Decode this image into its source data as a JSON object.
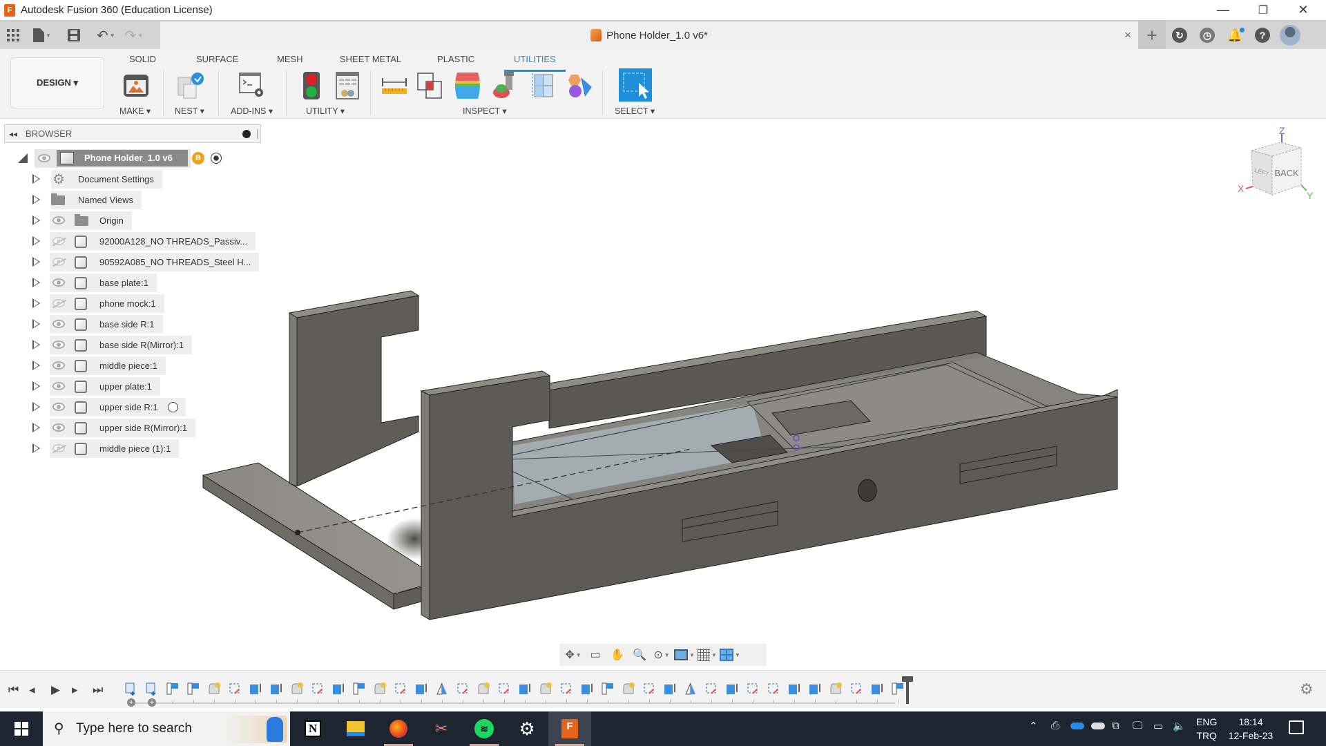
{
  "window": {
    "title": "Autodesk Fusion 360 (Education License)",
    "logo_letter": "F",
    "controls": {
      "minimize": "—",
      "restore": "❐",
      "close": "✕"
    }
  },
  "quick_access": {
    "icons": [
      "grid-menu-icon",
      "file-icon",
      "save-icon",
      "undo-icon",
      "redo-icon"
    ],
    "document_tab": {
      "name": "Phone Holder_1.0 v6*",
      "close": "×"
    },
    "right_icons": [
      "new-tab-icon",
      "extensions-icon",
      "job-status-icon",
      "notifications-icon",
      "help-icon",
      "user-avatar"
    ]
  },
  "ribbon": {
    "workspace": "DESIGN ▾",
    "tabs": [
      {
        "label": "SOLID",
        "active": false
      },
      {
        "label": "SURFACE",
        "active": false
      },
      {
        "label": "MESH",
        "active": false
      },
      {
        "label": "SHEET METAL",
        "active": false
      },
      {
        "label": "PLASTIC",
        "active": false
      },
      {
        "label": "UTILITIES",
        "active": true
      }
    ],
    "groups": [
      {
        "label": "MAKE ▾"
      },
      {
        "label": "NEST ▾"
      },
      {
        "label": "ADD-INS ▾"
      },
      {
        "label": "UTILITY ▾"
      },
      {
        "label": "INSPECT ▾"
      },
      {
        "label": "SELECT ▾"
      }
    ],
    "accent": "#1e8fd8"
  },
  "browser": {
    "title": "BROWSER",
    "root": {
      "label": "Phone Holder_1.0 v6",
      "badge": "B"
    },
    "items": [
      {
        "label": "Document Settings",
        "icon": "gear",
        "visible": null
      },
      {
        "label": "Named Views",
        "icon": "folder",
        "visible": null
      },
      {
        "label": "Origin",
        "icon": "folder",
        "visible": true
      },
      {
        "label": "92000A128_NO THREADS_Passiv...",
        "icon": "body",
        "visible": false
      },
      {
        "label": "90592A085_NO THREADS_Steel H...",
        "icon": "body",
        "visible": false
      },
      {
        "label": "base plate:1",
        "icon": "body",
        "visible": true
      },
      {
        "label": "phone mock:1",
        "icon": "body",
        "visible": false
      },
      {
        "label": "base side R:1",
        "icon": "body",
        "visible": true
      },
      {
        "label": "base side R(Mirror):1",
        "icon": "body",
        "visible": true
      },
      {
        "label": "middle piece:1",
        "icon": "body",
        "visible": true
      },
      {
        "label": "upper plate:1",
        "icon": "body",
        "visible": true
      },
      {
        "label": "upper side R:1",
        "icon": "body",
        "visible": true,
        "activate_radio": true
      },
      {
        "label": "upper side R(Mirror):1",
        "icon": "body",
        "visible": true
      },
      {
        "label": "middle piece (1):1",
        "icon": "body",
        "visible": false
      }
    ]
  },
  "viewcube": {
    "face": "BACK",
    "side": "LEFT",
    "axes": {
      "x": "X",
      "y": "Y",
      "z": "Z"
    }
  },
  "navbar": {
    "icons": [
      "orbit-icon",
      "look-at-icon",
      "pan-icon",
      "zoom-icon",
      "fit-icon",
      "display-settings-icon",
      "grid-icon",
      "viewports-icon"
    ]
  },
  "timeline": {
    "controls": [
      "first",
      "previous",
      "play",
      "next",
      "last"
    ],
    "features": [
      "component",
      "component",
      "sketch",
      "sketch",
      "fillet",
      "offset-plane",
      "extrude",
      "extrude",
      "fillet",
      "offset-plane",
      "extrude",
      "sketch",
      "fillet",
      "offset-plane",
      "extrude",
      "mirror",
      "offset-plane",
      "fillet",
      "offset-plane",
      "extrude",
      "fillet",
      "offset-plane",
      "extrude",
      "sketch",
      "fillet",
      "offset-plane",
      "extrude",
      "mirror",
      "offset-plane",
      "extrude",
      "offset-plane",
      "offset-plane",
      "extrude",
      "extrude",
      "fillet",
      "offset-plane",
      "extrude",
      "sketch"
    ]
  },
  "taskbar": {
    "search_placeholder": "Type here to search",
    "apps": [
      "notion",
      "file-explorer",
      "firefox",
      "snipping-tool",
      "spotify",
      "settings",
      "fusion-360"
    ],
    "tray": {
      "lang1": "ENG",
      "lang2": "TRQ",
      "time": "18:14",
      "date": "12-Feb-23"
    }
  }
}
